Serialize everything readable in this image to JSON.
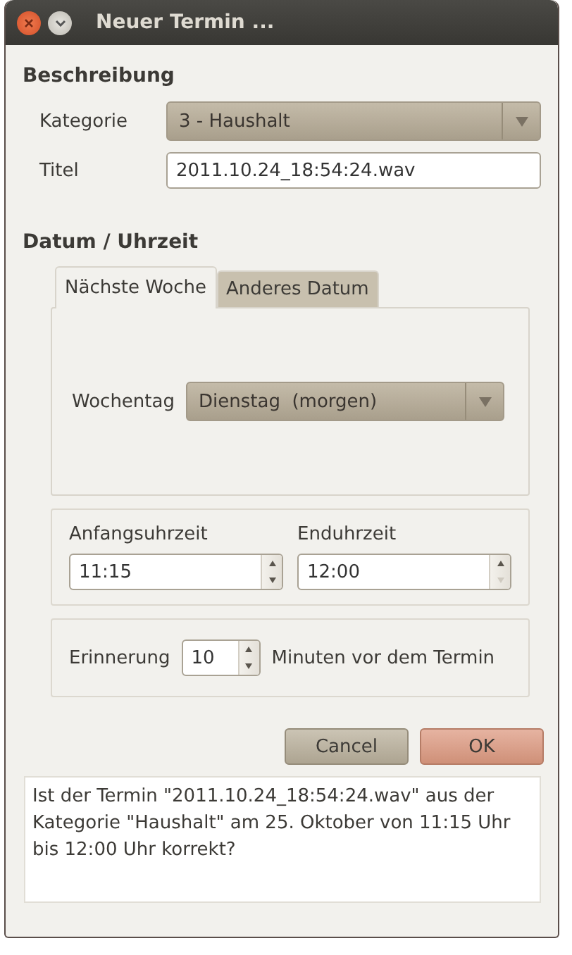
{
  "window": {
    "title": "Neuer Termin ..."
  },
  "description": {
    "heading": "Beschreibung",
    "category": {
      "label": "Kategorie",
      "value": "3 - Haushalt"
    },
    "title_field": {
      "label": "Titel",
      "value": "2011.10.24_18:54:24.wav"
    }
  },
  "date_time": {
    "heading": "Datum / Uhrzeit",
    "tabs": [
      {
        "label": "Nächste Woche",
        "selected": true
      },
      {
        "label": "Anderes Datum",
        "selected": false
      }
    ],
    "weekday": {
      "label": "Wochentag",
      "value": "Dienstag  (morgen)"
    },
    "start": {
      "label": "Anfangsuhrzeit",
      "value": "11:15",
      "down_disabled": false
    },
    "end": {
      "label": "Enduhrzeit",
      "value": "12:00",
      "down_disabled": true
    },
    "reminder": {
      "label": "Erinnerung",
      "value": "10",
      "suffix": "Minuten vor dem Termin"
    }
  },
  "buttons": [
    {
      "label": "Cancel",
      "kind": "cancel"
    },
    {
      "label": "OK",
      "kind": "ok"
    }
  ],
  "message": "Ist der Termin \"2011.10.24_18:54:24.wav\" aus der Kategorie \"Haushalt\" am 25. Oktober von 11:15 Uhr bis 12:00 Uhr korrekt?"
}
